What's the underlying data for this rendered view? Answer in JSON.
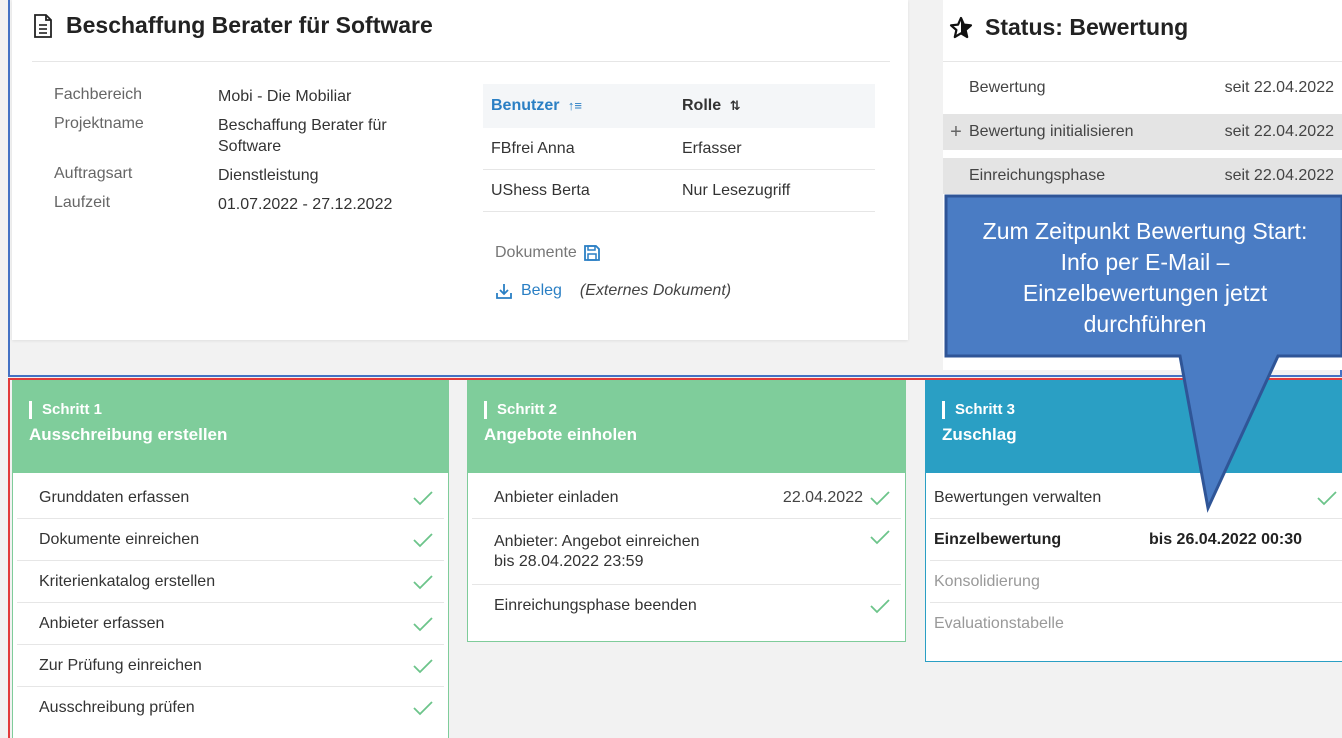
{
  "project": {
    "title": "Beschaffung Berater für Software",
    "details": [
      {
        "label": "Fachbereich",
        "value": "Mobi - Die Mobiliar"
      },
      {
        "label": "Projektname",
        "value": "Beschaffung Berater für Software"
      },
      {
        "label": "Auftragsart",
        "value": "Dienstleistung"
      },
      {
        "label": "Laufzeit",
        "value": "01.07.2022 - 27.12.2022"
      }
    ],
    "users_table": {
      "headers": [
        "Benutzer",
        "Rolle"
      ],
      "rows": [
        [
          "FBfrei Anna",
          "Erfasser"
        ],
        [
          "UShess Berta",
          "Nur Lesezugriff"
        ]
      ]
    },
    "documents_label": "Dokumente",
    "document": {
      "link": "Beleg",
      "note": "(Externes Dokument)"
    }
  },
  "status": {
    "title": "Status: Bewertung",
    "rows": [
      {
        "label": "Bewertung",
        "date": "seit 22.04.2022"
      },
      {
        "label": "Bewertung initialisieren",
        "date": "seit 22.04.2022"
      },
      {
        "label": "Einreichungsphase",
        "date": "seit 22.04.2022"
      }
    ]
  },
  "callout": {
    "text": "Zum Zeitpunkt Bewertung Start: Info per E-Mail – Einzelbewertungen jetzt durchführen"
  },
  "steps": [
    {
      "number": "Schritt 1",
      "name": "Ausschreibung erstellen",
      "items": [
        {
          "label": "Grunddaten erfassen"
        },
        {
          "label": "Dokumente einreichen"
        },
        {
          "label": "Kriterienkatalog erstellen"
        },
        {
          "label": "Anbieter erfassen"
        },
        {
          "label": "Zur Prüfung einreichen"
        },
        {
          "label": "Ausschreibung prüfen"
        }
      ]
    },
    {
      "number": "Schritt 2",
      "name": "Angebote einholen",
      "items": [
        {
          "label": "Anbieter einladen",
          "date": "22.04.2022"
        },
        {
          "label": "Anbieter: Angebot einreichen",
          "sub": "bis 28.04.2022 23:59"
        },
        {
          "label": "Einreichungsphase beenden"
        }
      ]
    },
    {
      "number": "Schritt 3",
      "name": "Zuschlag",
      "items": [
        {
          "label": "Bewertungen verwalten"
        },
        {
          "label": "Einzelbewertung",
          "date": "bis 26.04.2022 00:30"
        },
        {
          "label": "Konsolidierung"
        },
        {
          "label": "Evaluationstabelle"
        }
      ]
    }
  ],
  "colors": {
    "accent_blue": "#2a7fc4",
    "step_green": "#7fcd9b",
    "step_blue": "#2a9fc4",
    "check_green": "#6cc48a",
    "callout_fill": "#4a7cc4",
    "callout_border": "#2f5597"
  }
}
